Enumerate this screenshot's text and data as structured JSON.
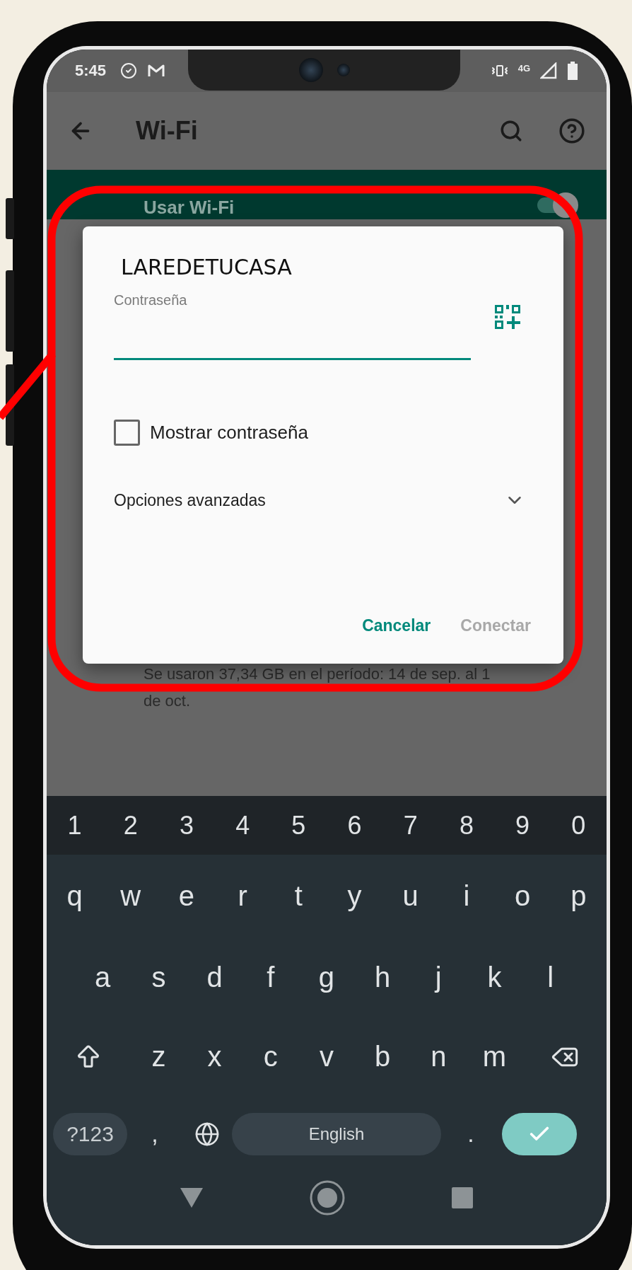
{
  "status_bar": {
    "time": "5:45",
    "network": "4G"
  },
  "toolbar": {
    "title": "Wi-Fi"
  },
  "wifi_toggle": {
    "label": "Usar Wi-Fi",
    "on": true
  },
  "usage_note": {
    "lines": [
      "Se usaron 37,34 GB en el período: 14 de sep. al 1",
      "de oct."
    ]
  },
  "dialog": {
    "title": "LAREDETUCASA",
    "password": {
      "label": "Contraseña"
    },
    "show_password": {
      "label": "Mostrar contraseña",
      "checked": false
    },
    "advanced": {
      "label": "Opciones avanzadas",
      "expanded": false
    },
    "buttons": [
      {
        "label": "Cancelar",
        "disabled": false
      },
      {
        "label": "Conectar",
        "disabled": true
      }
    ]
  },
  "keyboard": {
    "number_row": [
      "1",
      "2",
      "3",
      "4",
      "5",
      "6",
      "7",
      "8",
      "9",
      "0"
    ],
    "rows": [
      [
        "q",
        "w",
        "e",
        "r",
        "t",
        "y",
        "u",
        "i",
        "o",
        "p"
      ],
      [
        "a",
        "s",
        "d",
        "f",
        "g",
        "h",
        "j",
        "k",
        "l"
      ],
      [
        "z",
        "x",
        "c",
        "v",
        "b",
        "n",
        "m"
      ]
    ],
    "symbols_key": "?123",
    "comma": ",",
    "space": "English",
    "period": "."
  }
}
